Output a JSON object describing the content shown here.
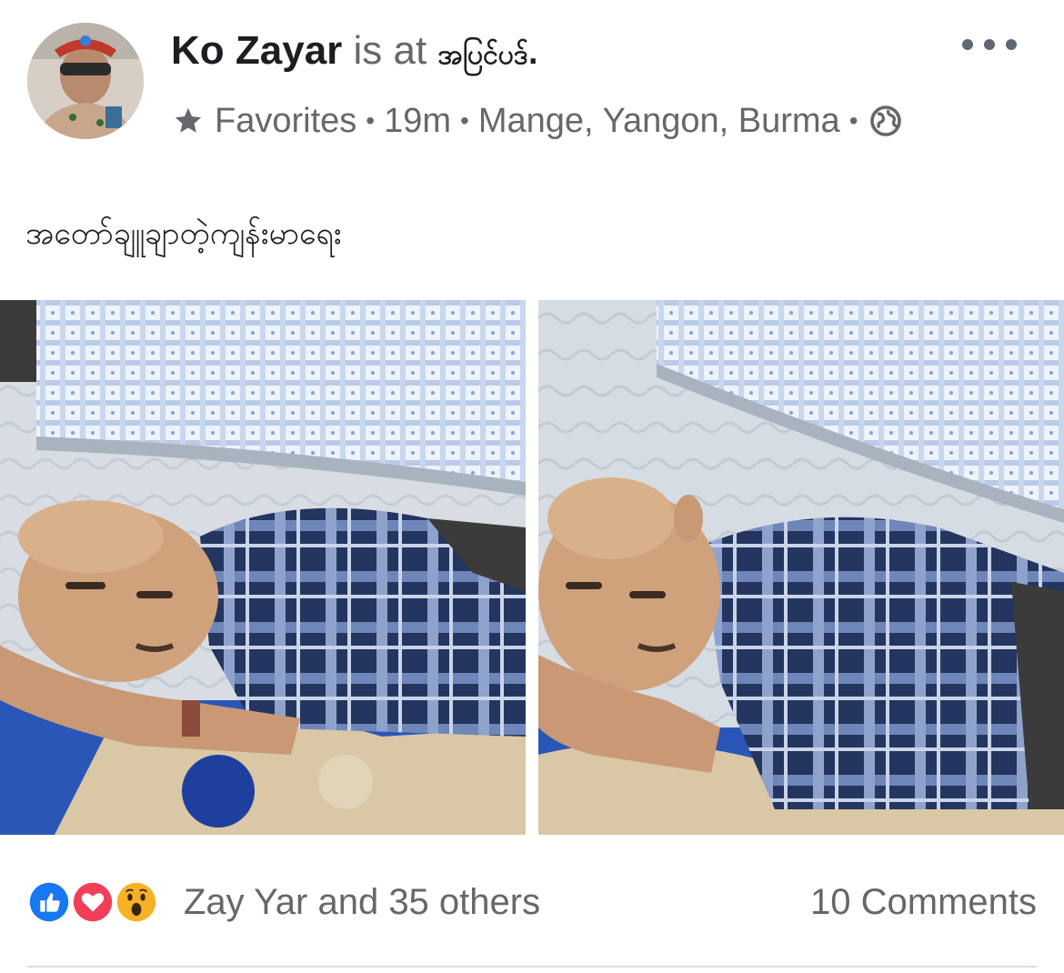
{
  "post": {
    "author": "Ko Zayar",
    "is_at": "is at",
    "place": "အပြင်ပဒ်.",
    "audience_label": "Favorites",
    "time": "19m",
    "location": "Mange, Yangon, Burma",
    "separator": "•",
    "caption": "အတော်ချူချာတဲ့ကျန်းမာရေး",
    "icons": {
      "audience": "star-icon",
      "privacy": "globe-icon",
      "more": "more-options-icon"
    }
  },
  "footer": {
    "reactions_text": "Zay Yar and 35 others",
    "comments_text": "10 Comments",
    "reaction_types": [
      "like",
      "love",
      "wow"
    ],
    "colors": {
      "like": "#1877f2",
      "love": "#f33e58",
      "wow": "#f7b125"
    }
  }
}
